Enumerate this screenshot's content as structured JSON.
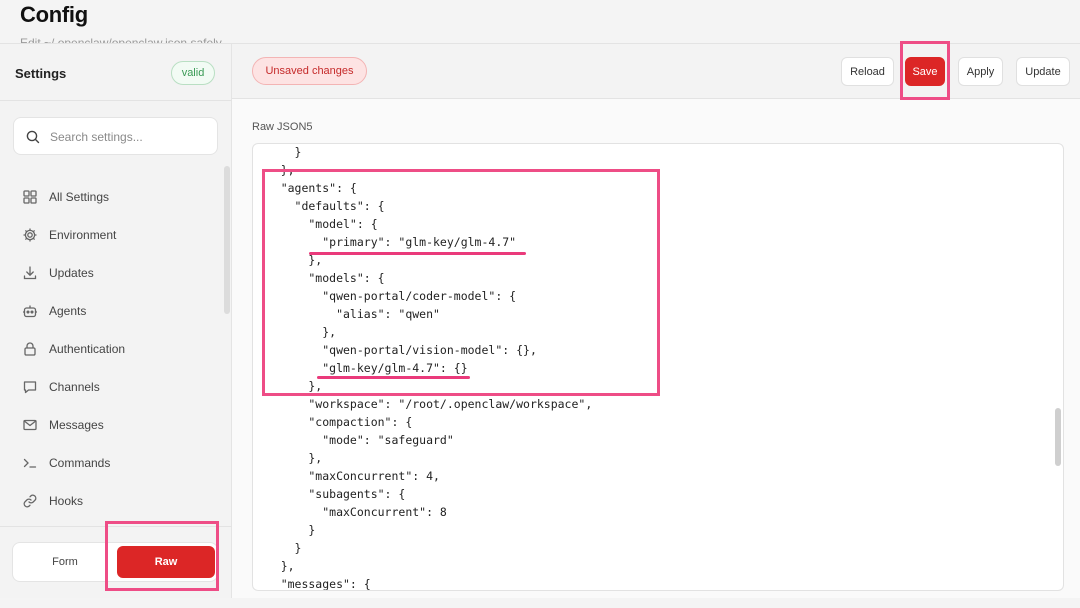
{
  "page": {
    "title": "Config",
    "subtitle": "Edit ~/.openclaw/openclaw.json safely"
  },
  "sidebar": {
    "title": "Settings",
    "status_badge": "valid",
    "search": {
      "placeholder": "Search settings...",
      "value": ""
    },
    "items": [
      {
        "label": "All Settings",
        "icon": "grid-icon"
      },
      {
        "label": "Environment",
        "icon": "gear-icon"
      },
      {
        "label": "Updates",
        "icon": "download-icon"
      },
      {
        "label": "Agents",
        "icon": "robot-icon"
      },
      {
        "label": "Authentication",
        "icon": "lock-icon"
      },
      {
        "label": "Channels",
        "icon": "chat-bubble-icon"
      },
      {
        "label": "Messages",
        "icon": "mail-icon"
      },
      {
        "label": "Commands",
        "icon": "terminal-icon"
      },
      {
        "label": "Hooks",
        "icon": "link-icon"
      }
    ],
    "mode": {
      "form_label": "Form",
      "raw_label": "Raw",
      "active": "Raw"
    }
  },
  "toolbar": {
    "unsaved_label": "Unsaved changes",
    "reload_label": "Reload",
    "save_label": "Save",
    "apply_label": "Apply",
    "update_label": "Update"
  },
  "editor": {
    "label": "Raw JSON5",
    "lines": [
      "      }",
      "    },",
      "    \"agents\": {",
      "      \"defaults\": {",
      "        \"model\": {",
      "          \"primary\": \"glm-key/glm-4.7\"",
      "        },",
      "        \"models\": {",
      "          \"qwen-portal/coder-model\": {",
      "            \"alias\": \"qwen\"",
      "          },",
      "          \"qwen-portal/vision-model\": {},",
      "          \"glm-key/glm-4.7\": {}",
      "        },",
      "        \"workspace\": \"/root/.openclaw/workspace\",",
      "        \"compaction\": {",
      "          \"mode\": \"safeguard\"",
      "        },",
      "        \"maxConcurrent\": 4,",
      "        \"subagents\": {",
      "          \"maxConcurrent\": 8",
      "        }",
      "      }",
      "    },",
      "    \"messages\": {"
    ]
  },
  "colors": {
    "accent": "#dc2626",
    "annotation": "#ee4d86",
    "valid": "#3a9a55"
  }
}
